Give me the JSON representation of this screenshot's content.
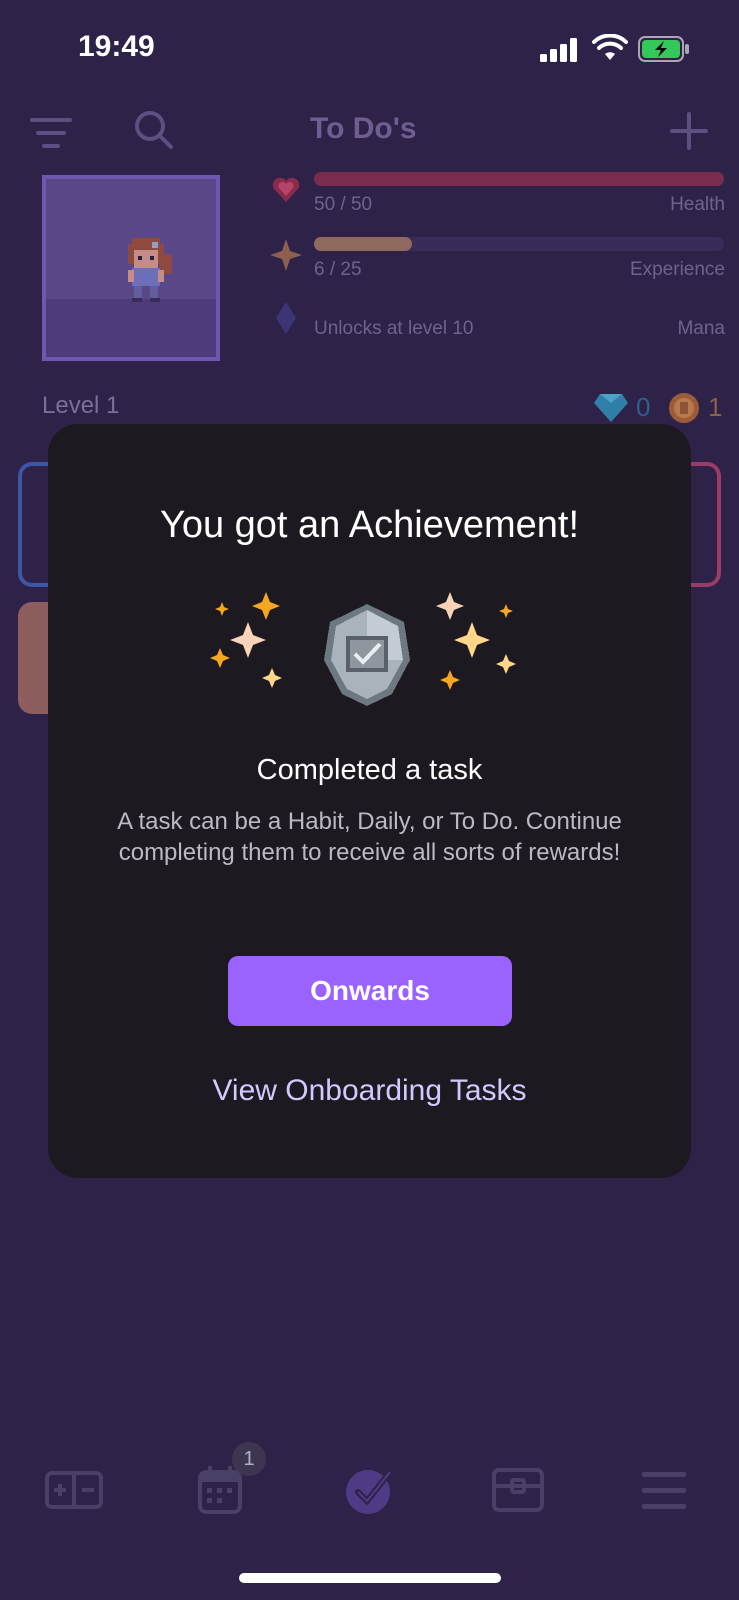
{
  "status_bar": {
    "time": "19:49",
    "icons": [
      "cellular-signal-icon",
      "wifi-icon",
      "battery-charging-icon"
    ]
  },
  "toolbar": {
    "title": "To Do's",
    "left_icons": [
      "filter-icon",
      "search-icon"
    ],
    "right_icons": [
      "add-icon"
    ]
  },
  "stats": {
    "health": {
      "value": "50 / 50",
      "label": "Health",
      "fraction": 1.0,
      "color": "#C92E5A"
    },
    "experience": {
      "value": "6 / 25",
      "label": "Experience",
      "fraction": 0.24,
      "color": "#E8A54B"
    },
    "mana": {
      "value": "Unlocks at level 10",
      "label": "Mana",
      "fraction": 0,
      "color": "#4B7BFF"
    }
  },
  "player": {
    "level": "Level 1",
    "gems": "0",
    "gold": "1"
  },
  "modal": {
    "title": "You got an Achievement!",
    "achievement_name": "Completed a task",
    "achievement_description": "A task can be a Habit, Daily, or To Do. Continue completing them to receive all sorts of rewards!",
    "primary_button": "Onwards",
    "secondary_link": "View Onboarding Tasks",
    "badge_icon": "completed-task-badge-icon"
  },
  "tab_bar": {
    "tabs": [
      "habits-tab-icon",
      "dailies-tab-icon",
      "todos-tab-icon",
      "rewards-tab-icon",
      "menu-tab-icon"
    ],
    "dailies_badge": "1",
    "active_tab": "todos-tab-icon"
  },
  "colors": {
    "background": "#2E2248",
    "modal_background": "#1C1920",
    "accent": "#9A62FF",
    "link": "#D5C8FF"
  }
}
